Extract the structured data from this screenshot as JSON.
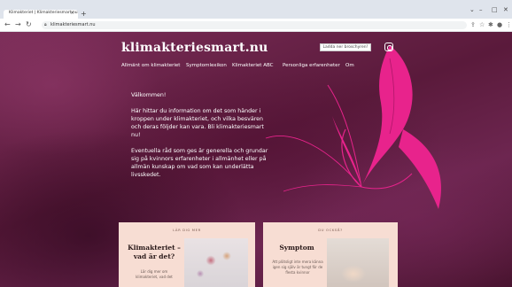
{
  "browser": {
    "tab_title": "Klimakteriet | Klimakteriesmart.nu",
    "url": "klimakteriesmart.nu"
  },
  "site": {
    "logo": "klimakteriesmart.nu",
    "cta_label": "Ladda ner broschyren!",
    "nav": [
      "Allmänt om klimakteriet",
      "Symptomlexikon",
      "Klimakteriet ABC",
      "Personliga erfarenheter",
      "Om"
    ]
  },
  "intro": {
    "greeting": "Välkommen!",
    "paragraph1": "Här hittar du information om det som händer i kroppen under klimakteriet, och vilka besvären och deras följder kan vara. Bli klimakteriesmart nu!",
    "paragraph2": "Eventuella råd som ges är generella och grundar sig på kvinnors erfarenheter i allmänhet eller på allmän kunskap om vad som kan underlätta livsskedet."
  },
  "cards": [
    {
      "kicker": "LÄR DIG MER",
      "title": "Klimakteriet – vad är det?",
      "text": "Lär dig mer om klimakteriet, vad det"
    },
    {
      "kicker": "DU OCKSÅ?",
      "title": "Symptom",
      "text": "Att plötsligt inte mera känna igen sig själv är tungt för de flesta kvinnor"
    }
  ],
  "colors": {
    "accent": "#e8238c",
    "card_bg": "#f7ddd3",
    "page_bg": "#5b1a3c"
  }
}
